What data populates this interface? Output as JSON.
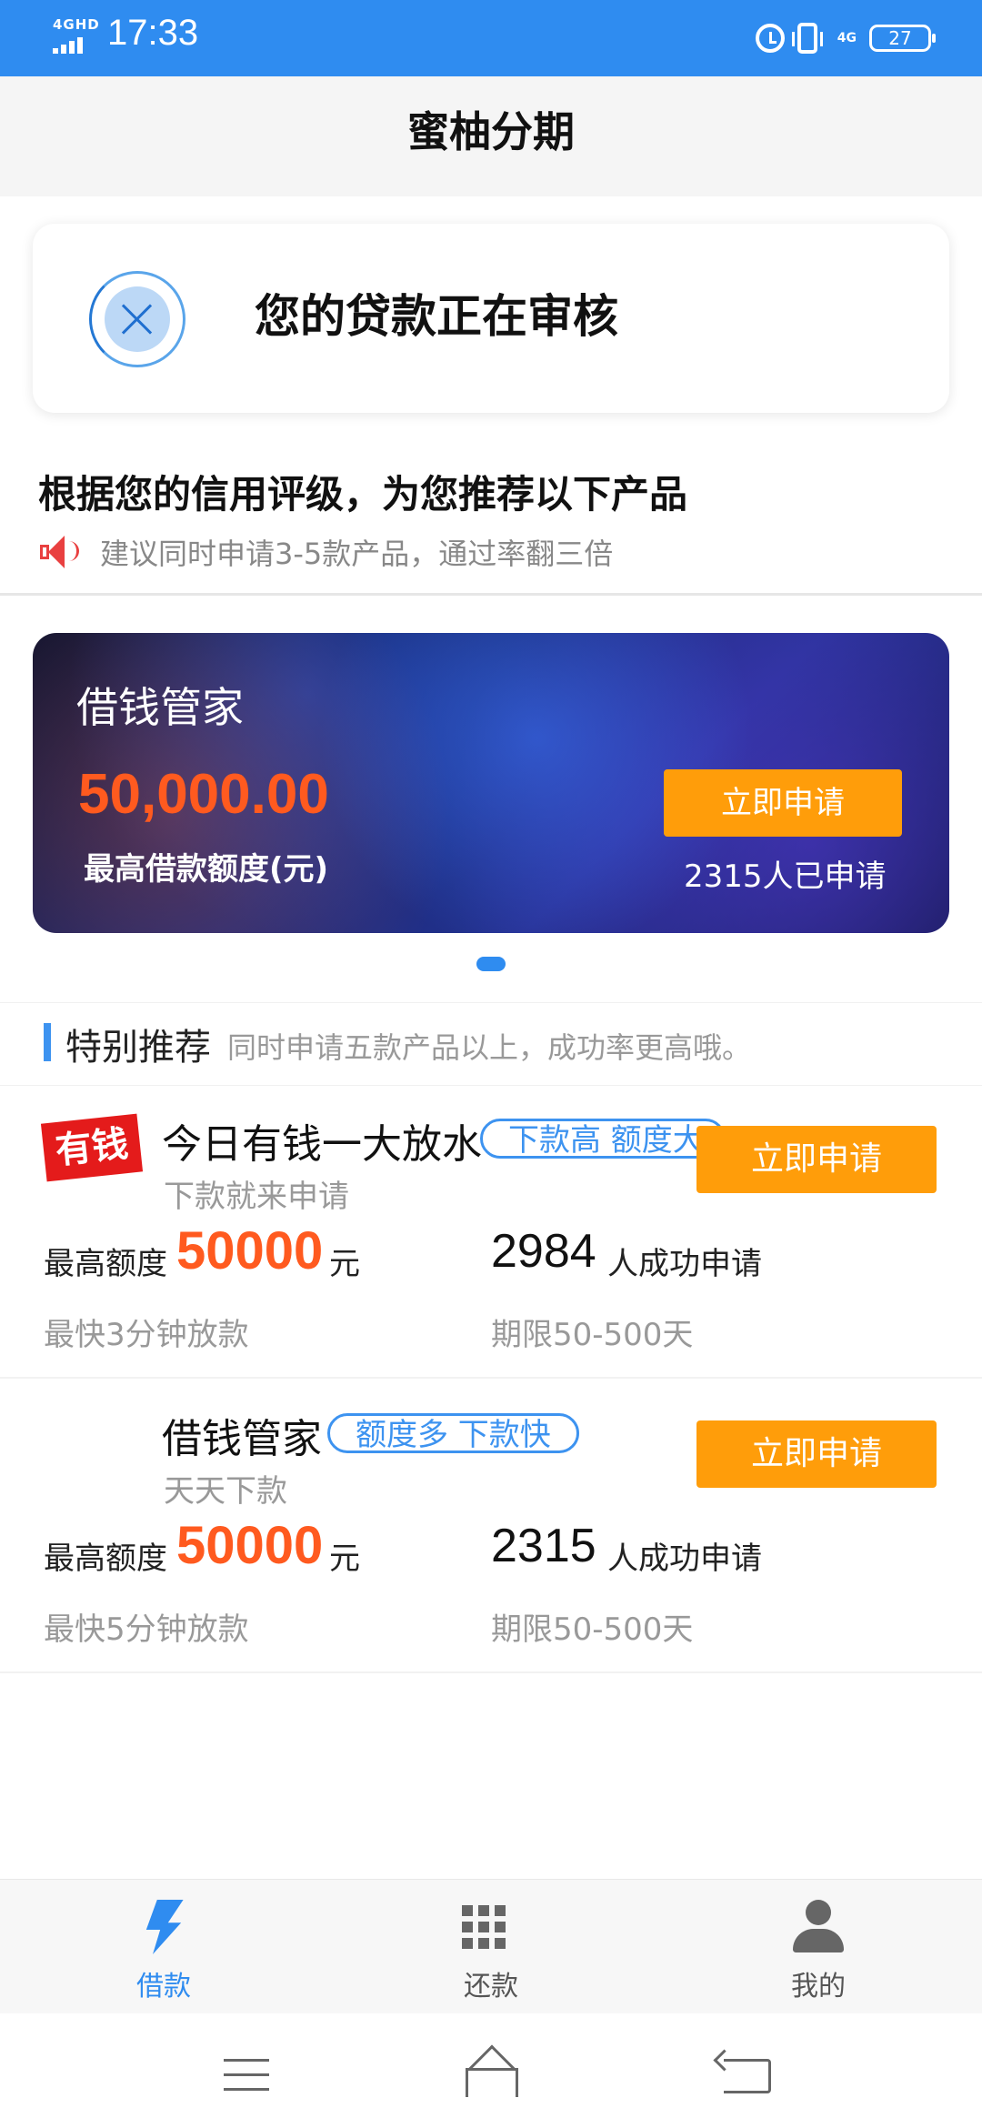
{
  "status_bar": {
    "network_label": "4GHD",
    "time": "17:33",
    "signal_label": "4G",
    "battery": "27"
  },
  "header": {
    "title": "蜜柚分期"
  },
  "status_card": {
    "message": "您的贷款正在审核"
  },
  "recommend": {
    "title": "根据您的信用评级，为您推荐以下产品",
    "subtitle": "建议同时申请3-5款产品，通过率翻三倍"
  },
  "banner": {
    "product_name": "借钱管家",
    "amount": "50,000.00",
    "amount_label": "最高借款额度(元)",
    "apply_label": "立即申请",
    "applied_text": "2315人已申请"
  },
  "special": {
    "label": "特别推荐",
    "description": "同时申请五款产品以上，成功率更高哦。"
  },
  "products": [
    {
      "logo_text": "有钱",
      "name": "今日有钱一大放水",
      "tags": "下款高 额度大",
      "subtitle": "下款就来申请",
      "apply_label": "立即申请",
      "max_label": "最高额度",
      "max_value": "50000",
      "unit": "元",
      "count": "2984",
      "count_label": "人成功申请",
      "speed": "最快3分钟放款",
      "term": "期限50-500天"
    },
    {
      "logo_text": "",
      "name": "借钱管家",
      "tags": "额度多 下款快",
      "subtitle": "天天下款",
      "apply_label": "立即申请",
      "max_label": "最高额度",
      "max_value": "50000",
      "unit": "元",
      "count": "2315",
      "count_label": "人成功申请",
      "speed": "最快5分钟放款",
      "term": "期限50-500天"
    }
  ],
  "tabs": [
    {
      "label": "借款",
      "icon": "lightning-icon",
      "active": true
    },
    {
      "label": "还款",
      "icon": "grid-icon",
      "active": false
    },
    {
      "label": "我的",
      "icon": "user-icon",
      "active": false
    }
  ],
  "colors": {
    "primary": "#2f8cf0",
    "accent_orange": "#ff9d0a",
    "amount_red": "#ff5a1f"
  }
}
